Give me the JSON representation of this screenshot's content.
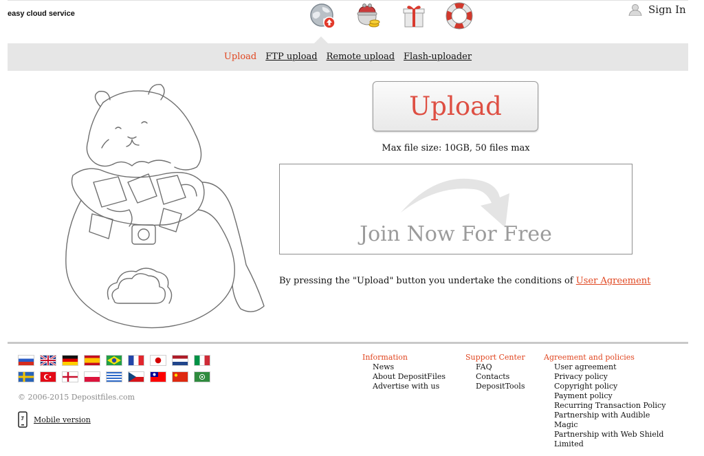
{
  "header": {
    "brand": "easy cloud service",
    "sign_in": "Sign In",
    "nav_icons": [
      "globe-upload-icon",
      "coin-purse-icon",
      "gift-box-icon",
      "lifebuoy-icon"
    ]
  },
  "subnav": {
    "items": [
      {
        "label": "Upload",
        "active": true
      },
      {
        "label": "FTP upload",
        "active": false
      },
      {
        "label": "Remote upload",
        "active": false
      },
      {
        "label": "Flash-uploader",
        "active": false
      }
    ]
  },
  "main": {
    "upload_button": "Upload",
    "max_file_size": "Max file size: 10GB, 50 files max",
    "join_banner": "Join Now For Free",
    "terms_prefix": "By pressing the \"Upload\" button you undertake the conditions of ",
    "terms_link": "User Agreement"
  },
  "footer": {
    "flags": [
      "russia",
      "uk",
      "germany",
      "spain",
      "brazil",
      "france",
      "japan",
      "netherlands",
      "italy",
      "sweden",
      "turkey",
      "denmark",
      "poland",
      "greece",
      "czech",
      "taiwan",
      "china",
      "saudi-arabia"
    ],
    "copyright": "© 2006-2015 Depositfiles.com",
    "mobile_version": "Mobile version",
    "columns": [
      {
        "heading": "Information",
        "items": [
          "News",
          "About DepositFiles",
          "Advertise with us"
        ]
      },
      {
        "heading": "Support Center",
        "items": [
          "FAQ",
          "Contacts",
          "DepositTools"
        ]
      },
      {
        "heading": "Agreement and policies",
        "items": [
          "User agreement",
          "Privacy policy",
          "Copyright policy",
          "Payment policy",
          "Recurring Transaction Policy",
          "Partnership with Audible",
          "Magic",
          "Partnership with Web Shield",
          "Limited"
        ]
      }
    ]
  },
  "colors": {
    "accent": "#e0451f",
    "upload_text": "#de4f43",
    "bar": "#e6e6e6"
  }
}
